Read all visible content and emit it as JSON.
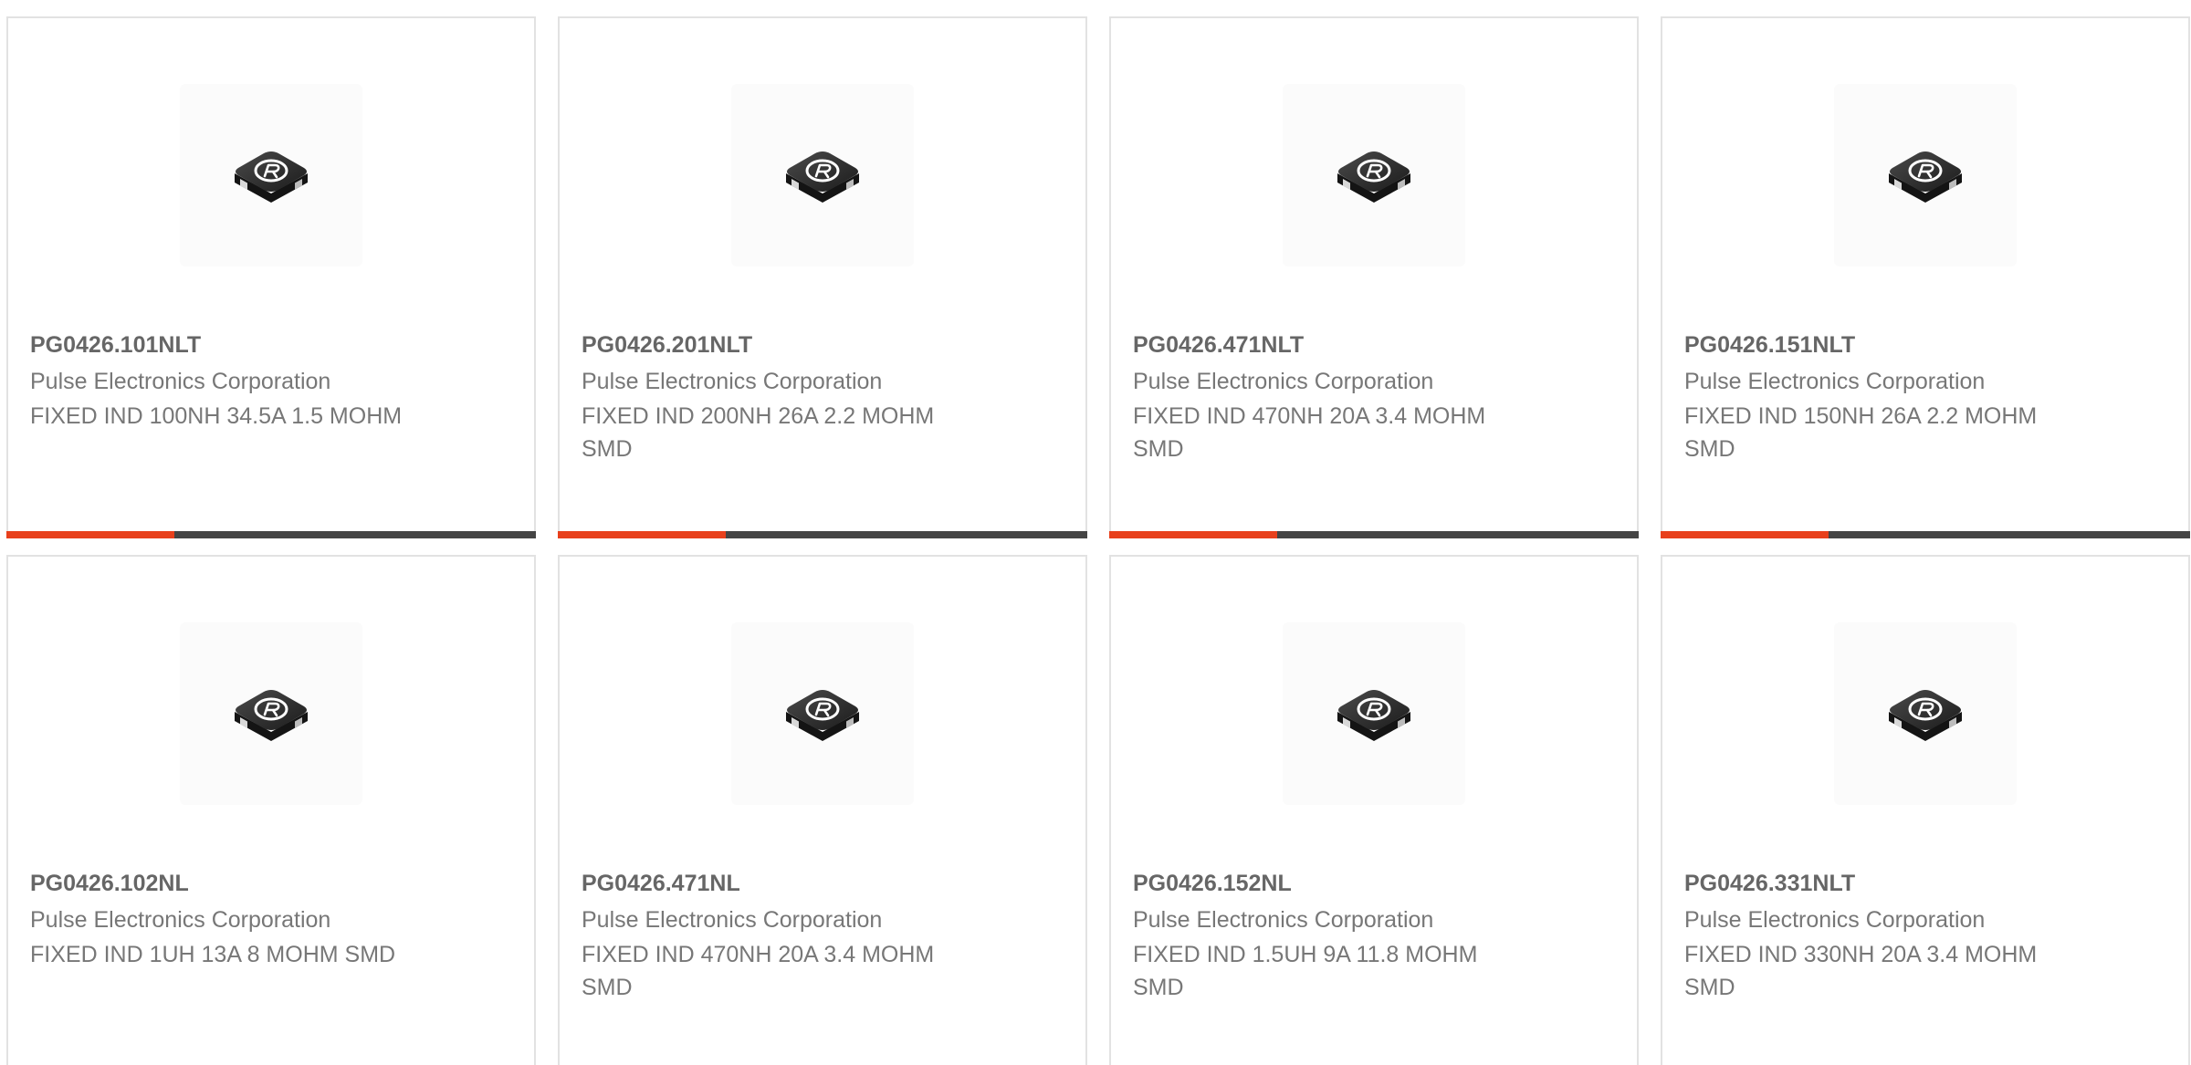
{
  "colors": {
    "accent": "#e8401c",
    "bar": "#444444",
    "border": "#e2e2e2",
    "text_bold": "#666666",
    "text": "#777777"
  },
  "products": [
    {
      "part_number": "PG0426.101NLT",
      "manufacturer": "Pulse Electronics Corporation",
      "description": "FIXED IND 100NH 34.5A 1.5 MOHM",
      "image_icon": "inductor-image-icon"
    },
    {
      "part_number": "PG0426.201NLT",
      "manufacturer": "Pulse Electronics Corporation",
      "description": "FIXED IND 200NH 26A 2.2 MOHM SMD",
      "image_icon": "inductor-image-icon"
    },
    {
      "part_number": "PG0426.471NLT",
      "manufacturer": "Pulse Electronics Corporation",
      "description": "FIXED IND 470NH 20A 3.4 MOHM SMD",
      "image_icon": "inductor-image-icon"
    },
    {
      "part_number": "PG0426.151NLT",
      "manufacturer": "Pulse Electronics Corporation",
      "description": "FIXED IND 150NH 26A 2.2 MOHM SMD",
      "image_icon": "inductor-image-icon"
    },
    {
      "part_number": "PG0426.102NL",
      "manufacturer": "Pulse Electronics Corporation",
      "description": "FIXED IND 1UH 13A 8 MOHM SMD",
      "image_icon": "inductor-image-icon"
    },
    {
      "part_number": "PG0426.471NL",
      "manufacturer": "Pulse Electronics Corporation",
      "description": "FIXED IND 470NH 20A 3.4 MOHM SMD",
      "image_icon": "inductor-image-icon"
    },
    {
      "part_number": "PG0426.152NL",
      "manufacturer": "Pulse Electronics Corporation",
      "description": "FIXED IND 1.5UH 9A 11.8 MOHM SMD",
      "image_icon": "inductor-image-icon"
    },
    {
      "part_number": "PG0426.331NLT",
      "manufacturer": "Pulse Electronics Corporation",
      "description": "FIXED IND 330NH 20A 3.4 MOHM SMD",
      "image_icon": "inductor-image-icon"
    }
  ]
}
